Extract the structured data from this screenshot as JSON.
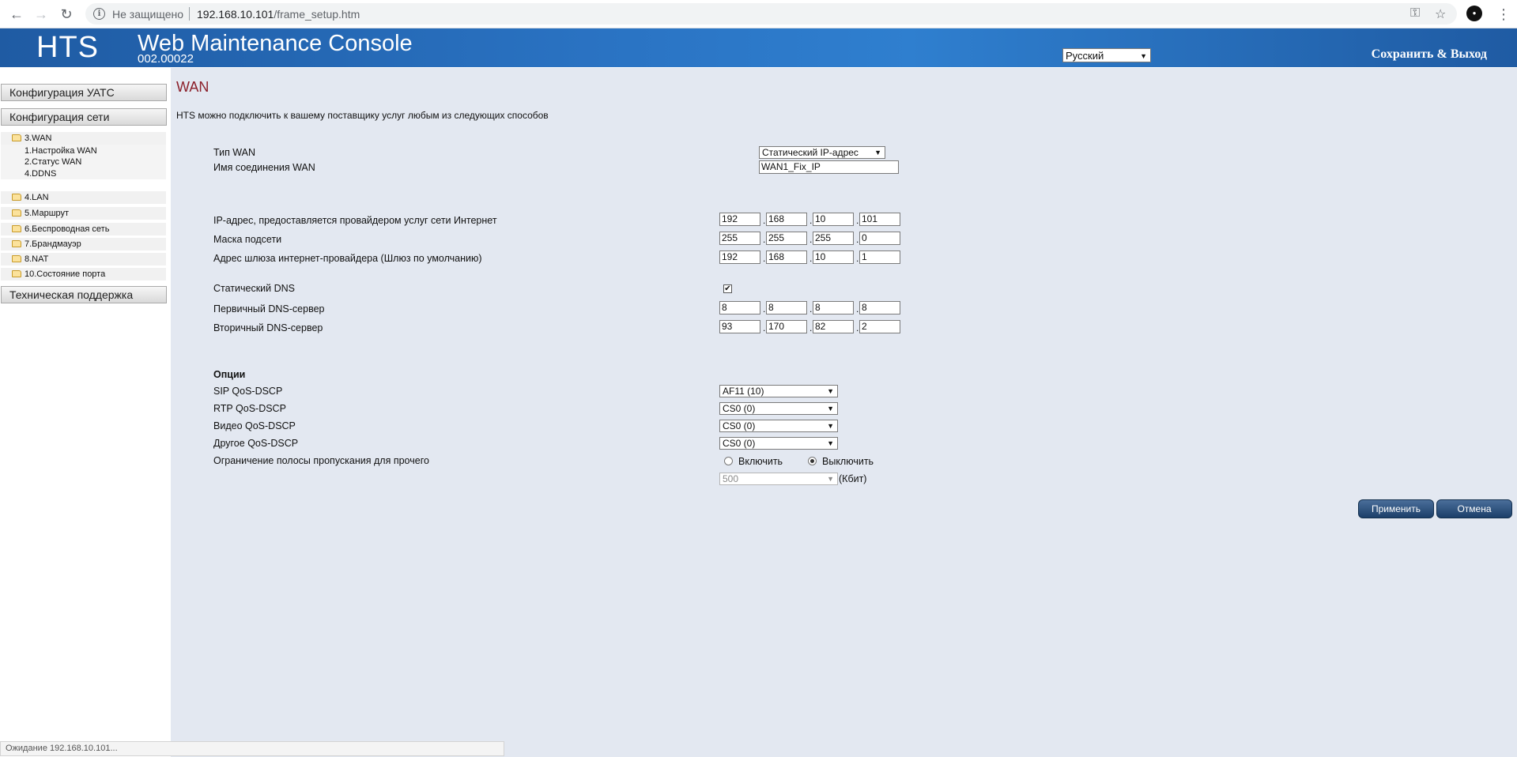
{
  "browser": {
    "security_label": "Не защищено",
    "url_host": "192.168.10.101",
    "url_path": "/frame_setup.htm"
  },
  "header": {
    "logo": "HTS",
    "title": "Web Maintenance Console",
    "version": "002.00022",
    "language": "Русский",
    "save_exit": "Сохранить & Выход"
  },
  "sidebar": {
    "pbx_config": "Конфигурация УАТС",
    "network_config": "Конфигурация сети",
    "wan": "3.WAN",
    "wan_sub": [
      "1.Настройка WAN",
      "2.Статус WAN",
      "4.DDNS"
    ],
    "items": [
      "4.LAN",
      "5.Маршрут",
      "6.Беспроводная сеть",
      "7.Брандмауэр",
      "8.NAT",
      "10.Состояние порта"
    ],
    "support": "Техническая поддержка"
  },
  "main": {
    "title": "WAN",
    "intro": "HTS можно подключить к вашему поставщику услуг любым из следующих способов",
    "wan_type_label": "Тип WAN",
    "wan_type_value": "Статический IP-адрес",
    "conn_name_label": "Имя соединения WAN",
    "conn_name_value": "WAN1_Fix_IP",
    "ip_label": "IP-адрес, предоставляется провайдером услуг сети Интернет",
    "ip": [
      "192",
      "168",
      "10",
      "101"
    ],
    "mask_label": "Маска подсети",
    "mask": [
      "255",
      "255",
      "255",
      "0"
    ],
    "gateway_label": "Адрес шлюза интернет-провайдера (Шлюз по умолчанию)",
    "gateway": [
      "192",
      "168",
      "10",
      "1"
    ],
    "static_dns_label": "Статический DNS",
    "static_dns_checked": "✔",
    "dns1_label": "Первичный DNS-сервер",
    "dns1": [
      "8",
      "8",
      "8",
      "8"
    ],
    "dns2_label": "Вторичный DNS-сервер",
    "dns2": [
      "93",
      "170",
      "82",
      "2"
    ],
    "options_heading": "Опции",
    "sip_label": "SIP QoS-DSCP",
    "sip_value": "AF11 (10)",
    "rtp_label": "RTP QoS-DSCP",
    "rtp_value": "CS0 (0)",
    "video_label": "Видео QoS-DSCP",
    "video_value": "CS0 (0)",
    "other_label": "Другое QoS-DSCP",
    "other_value": "CS0 (0)",
    "bw_label": "Ограничение полосы пропускания для прочего",
    "bw_on": "Включить",
    "bw_off": "Выключить",
    "bw_value": "500",
    "bw_unit": "(Кбит)",
    "apply": "Применить",
    "cancel": "Отмена"
  },
  "status_bar": "Ожидание 192.168.10.101..."
}
